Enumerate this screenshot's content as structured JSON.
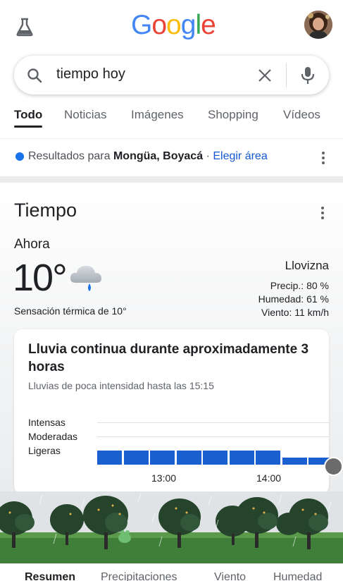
{
  "header": {
    "logo_letters": [
      "G",
      "o",
      "o",
      "g",
      "l",
      "e"
    ],
    "logo_colors": [
      "#4285F4",
      "#EA4335",
      "#FBBC05",
      "#4285F4",
      "#34A853",
      "#EA4335"
    ]
  },
  "search": {
    "query": "tiempo hoy"
  },
  "tabs": [
    {
      "label": "Todo"
    },
    {
      "label": "Noticias"
    },
    {
      "label": "Imágenes"
    },
    {
      "label": "Shopping"
    },
    {
      "label": "Vídeos"
    }
  ],
  "location": {
    "prefix": "Resultados para",
    "place": "Mongüa, Boyacá",
    "separator": "·",
    "link": "Elegir área"
  },
  "weather": {
    "title": "Tiempo",
    "now_label": "Ahora",
    "temperature": "10°",
    "feels_like": "Sensación térmica de 10°",
    "condition": "Llovizna",
    "precip": "Precip.: 80 %",
    "humidity": "Humedad: 61 %",
    "wind": "Viento: 11 km/h",
    "icon": "cloud-rain-icon"
  },
  "rain_card": {
    "title": "Lluvia continua durante aproximadamente 3 horas",
    "subtitle": "Lluvias de poca intensidad hasta las 15:15",
    "levels": [
      "Intensas",
      "Moderadas",
      "Ligeras"
    ],
    "time_labels": [
      "13:00",
      "14:00"
    ],
    "intensity_bars": [
      1,
      1,
      1,
      1,
      1,
      1,
      1,
      0.5,
      0.5
    ]
  },
  "bottom_tabs": [
    {
      "label": "Resumen"
    },
    {
      "label": "Precipitaciones"
    },
    {
      "label": "Viento"
    },
    {
      "label": "Humedad"
    }
  ],
  "colors": {
    "accent_blue": "#1a73e8",
    "bar_blue": "#1a5fd0",
    "link_blue": "#1558d6"
  }
}
